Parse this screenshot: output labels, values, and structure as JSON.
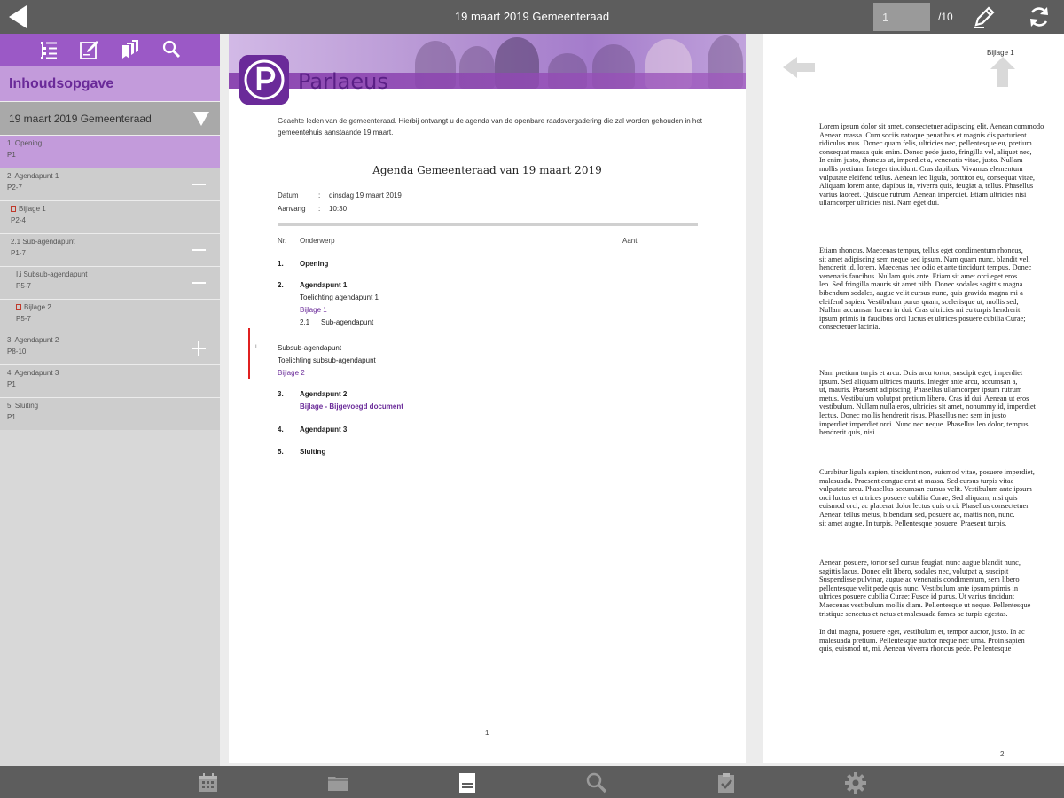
{
  "topbar": {
    "title": "19 maart 2019 Gemeenteraad",
    "page_value": "1",
    "page_total": "/10",
    "back_icon": "back-arrow-icon",
    "edit_icon": "pencil-icon",
    "sync_icon": "sync-icon"
  },
  "sidebar": {
    "toolbar_icons": [
      "toc-list-icon",
      "notes-icon",
      "bookmarks-icon",
      "search-icon"
    ],
    "toc_title": "Inhoudsopgave",
    "meeting": "19 maart 2019 Gemeenteraad",
    "items": [
      {
        "label": "1. Opening",
        "pages": "P1",
        "active": true,
        "ctrl": ""
      },
      {
        "label": "2. Agendapunt 1",
        "pages": "P2-7",
        "ctrl": "collapse"
      },
      {
        "label": "Bijlage 1",
        "pages": "P2-4",
        "ctrl": "",
        "attachment": true
      },
      {
        "label": "2.1 Sub-agendapunt",
        "pages": "P1-7",
        "ctrl": "collapse"
      },
      {
        "label": "I.i Subsub-agendapunt",
        "pages": "P5-7",
        "ctrl": "collapse"
      },
      {
        "label": "Bijlage 2",
        "pages": "P5-7",
        "ctrl": "",
        "attachment": true
      },
      {
        "label": "3. Agendapunt 2",
        "pages": "P8-10",
        "ctrl": "expand"
      },
      {
        "label": "4. Agendapunt 3",
        "pages": "P1",
        "ctrl": ""
      },
      {
        "label": "5. Sluiting",
        "pages": "P1",
        "ctrl": ""
      }
    ]
  },
  "document": {
    "brand": "Parlaeus",
    "intro": "Geachte leden van de gemeenteraad. Hierbij ontvangt u de agenda van de openbare raadsvergadering die zal worden gehouden in het gemeentehuis aanstaande 19 maart.",
    "heading": "Agenda Gemeenteraad van 19 maart 2019",
    "meta": [
      {
        "key": "Datum",
        "value": "dinsdag 19 maart 2019"
      },
      {
        "key": "Aanvang",
        "value": "10:30"
      }
    ],
    "columns": {
      "nr": "Nr.",
      "subject": "Onderwerp",
      "count": "Aant"
    },
    "agenda": {
      "n1": "1.",
      "t1": "Opening",
      "n2": "2.",
      "t2": "Agendapunt 1",
      "t2_note": "Toelichting agendapunt 1",
      "t2_link": "Bijlage 1",
      "t2_sub_nr": "2.1",
      "t2_sub": "Sub-agendapunt",
      "n_sub": "I",
      "t_sub": "Subsub-agendapunt",
      "t_sub_note": "Toelichting subsub-agendapunt",
      "t_sub_link": "Bijlage 2",
      "n3": "3.",
      "t3": "Agendapunt 2",
      "t3_link": "Bijlage - Bijgevoegd document",
      "n4": "4.",
      "t4": "Agendapunt 3",
      "n5": "5.",
      "t5": "Sluiting"
    },
    "page_number": "1"
  },
  "right_page": {
    "label": "Bijlage 1",
    "page_number": "2",
    "paragraphs": [
      [
        "Lorem ipsum dolor sit amet, consectetuer adipiscing elit. Aenean commodo",
        "Aenean massa. Cum sociis natoque penatibus et magnis dis parturient",
        "ridiculus mus. Donec quam felis, ultricies nec, pellentesque eu, pretium",
        "consequat massa quis enim. Donec pede justo, fringilla vel, aliquet nec,",
        "In enim justo, rhoncus ut, imperdiet a, venenatis vitae, justo. Nullam",
        "mollis pretium. Integer tincidunt. Cras dapibus. Vivamus elementum",
        "vulputate eleifend tellus. Aenean leo ligula, porttitor eu, consequat vitae,",
        "Aliquam lorem ante, dapibus in, viverra quis, feugiat a, tellus. Phasellus",
        "varius laoreet. Quisque rutrum. Aenean imperdiet. Etiam ultricies nisi",
        "ullamcorper ultricies nisi. Nam eget dui."
      ],
      [
        "Etiam rhoncus. Maecenas tempus, tellus eget condimentum rhoncus,",
        "sit amet adipiscing sem neque sed ipsum. Nam quam nunc, blandit vel,",
        "hendrerit id, lorem. Maecenas nec odio et ante tincidunt tempus. Donec",
        "venenatis faucibus. Nullam quis ante. Etiam sit amet orci eget eros",
        "leo. Sed fringilla mauris sit amet nibh. Donec sodales sagittis magna.",
        "bibendum sodales, augue velit cursus nunc, quis gravida magna mi a",
        "eleifend sapien. Vestibulum purus quam, scelerisque ut, mollis sed,",
        "Nullam accumsan lorem in dui. Cras ultricies mi eu turpis hendrerit",
        "ipsum primis in faucibus orci luctus et ultrices posuere cubilia Curae;",
        "consectetuer lacinia."
      ],
      [
        "Nam pretium turpis et arcu. Duis arcu tortor, suscipit eget, imperdiet",
        "ipsum. Sed aliquam ultrices mauris. Integer ante arcu, accumsan a,",
        "ut, mauris. Praesent adipiscing. Phasellus ullamcorper ipsum rutrum",
        "metus. Vestibulum volutpat pretium libero. Cras id dui. Aenean ut eros",
        "vestibulum. Nullam nulla eros, ultricies sit amet, nonummy id, imperdiet",
        "lectus. Donec mollis hendrerit risus. Phasellus nec sem in justo",
        "imperdiet imperdiet orci. Nunc nec neque. Phasellus leo dolor, tempus",
        "hendrerit quis, nisi."
      ],
      [
        "Curabitur ligula sapien, tincidunt non, euismod vitae, posuere imperdiet,",
        "malesuada. Praesent congue erat at massa. Sed cursus turpis vitae",
        "vulputate arcu. Phasellus accumsan cursus velit. Vestibulum ante ipsum",
        "orci luctus et ultrices posuere cubilia Curae; Sed aliquam, nisi quis",
        "euismod orci, ac placerat dolor lectus quis orci. Phasellus consectetuer",
        "Aenean tellus metus, bibendum sed, posuere ac, mattis non, nunc.",
        "sit amet augue. In turpis. Pellentesque posuere. Praesent turpis."
      ],
      [
        "Aenean posuere, tortor sed cursus feugiat, nunc augue blandit nunc,",
        "sagittis lacus. Donec elit libero, sodales nec, volutpat a, suscipit",
        "Suspendisse pulvinar, augue ac venenatis condimentum, sem libero",
        "pellentesque velit pede quis nunc. Vestibulum ante ipsum primis in",
        "ultrices posuere cubilia Curae; Fusce id purus. Ut varius tincidunt",
        "Maecenas vestibulum mollis diam. Pellentesque ut neque. Pellentesque",
        "tristique senectus et netus et malesuada fames ac turpis egestas."
      ],
      [
        "In dui magna, posuere eget, vestibulum et, tempor auctor, justo. In ac",
        "malesuada pretium. Pellentesque auctor neque nec urna. Proin sapien",
        "quis, euismod ut, mi. Aenean viverra rhoncus pede. Pellentesque"
      ]
    ]
  },
  "bottombar": {
    "icons": [
      "calendar-icon",
      "folder-icon",
      "document-icon",
      "search-icon",
      "clipboard-check-icon",
      "settings-icon"
    ]
  },
  "colors": {
    "bar": "#5d5d5d",
    "purple": "#9b59c6",
    "purple_light": "#c39bdb",
    "brand": "#5a1f86",
    "agenda_link": "#6a2a99"
  }
}
